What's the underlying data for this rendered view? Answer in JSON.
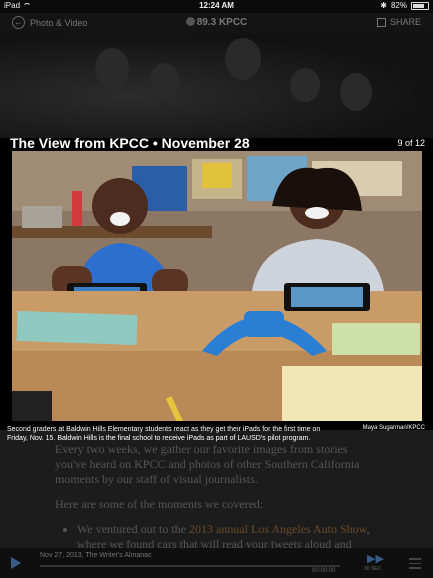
{
  "status_bar": {
    "device": "iPad",
    "time": "12:24 AM",
    "battery": "82%",
    "battery_level": 0.82
  },
  "app_bar": {
    "back_label": "Photo & Video",
    "brand": "89.3 KPCC",
    "share_label": "SHARE"
  },
  "gallery": {
    "title": "The View from KPCC • November 28",
    "counter": "9 of 12",
    "caption": "Second graders at Baldwin Hills Elementary students react as they get their iPads for the first time on Friday, Nov. 15. Baldwin Hills is the final school to receive iPads as part of LAUSD's pilot program.",
    "credit": "Maya Sugarman/KPCC"
  },
  "article": {
    "paragraph1": "Every two weeks, we gather our favorite images from stories you've heard on KPCC and photos of other Southern California moments by our staff of visual journalists.",
    "paragraph2": "Here are some of the moments we covered:",
    "bullet_prefix": "We ventured out to the ",
    "bullet_link": "2013 annual Los Angeles Auto Show",
    "bullet_suffix": ", where we found cars that will read your tweets aloud and"
  },
  "audio_bar": {
    "episode": "Nov 27, 2013, The Writer's Almanac",
    "time": "00:00:00",
    "ff_label": "30 SEC",
    "progress": 0.0
  },
  "colors": {
    "accent": "#3a5c88",
    "link": "#6a4b2a"
  }
}
